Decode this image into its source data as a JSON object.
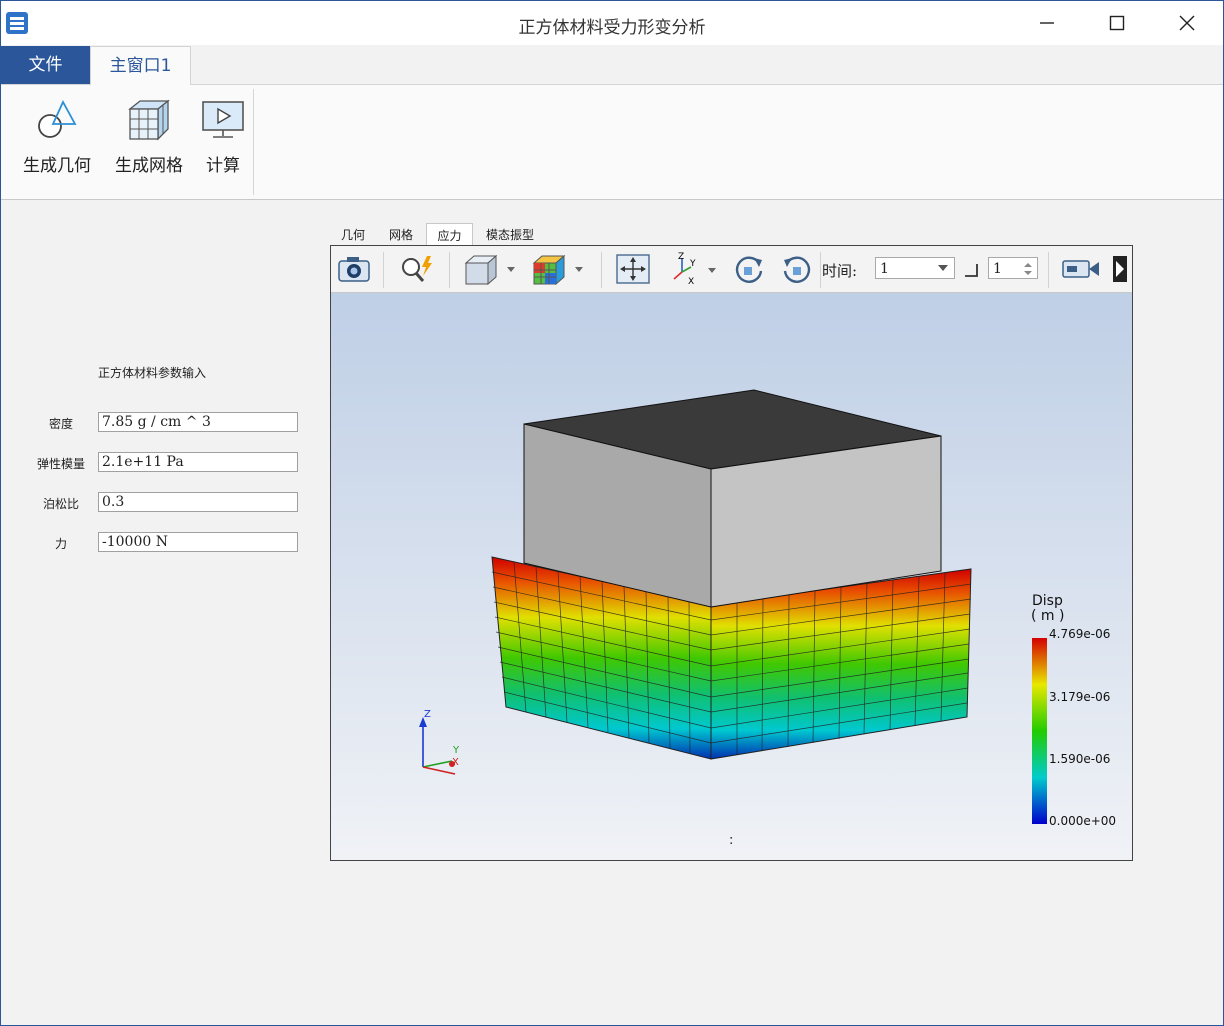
{
  "window": {
    "title": "正方体材料受力形变分析"
  },
  "ribbon": {
    "tabs": {
      "file": "文件",
      "main": "主窗口1"
    },
    "buttons": {
      "geometry": "生成几何",
      "mesh": "生成网格",
      "compute": "计算"
    }
  },
  "form": {
    "title": "正方体材料参数输入",
    "density": {
      "label": "密度",
      "value": "7.85 g / cm ^ 3"
    },
    "modulus": {
      "label": "弹性模量",
      "value": "2.1e+11 Pa"
    },
    "poisson": {
      "label": "泊松比",
      "value": "0.3"
    },
    "force": {
      "label": "力",
      "value": "-10000 N"
    }
  },
  "view_tabs": [
    "几何",
    "网格",
    "应力",
    "模态振型"
  ],
  "viewer": {
    "time_label": "时间:",
    "time_value": "1",
    "step_value": "1",
    "status_text": ":",
    "legend": {
      "title": "Disp",
      "unit": "( m )",
      "ticks": [
        "4.769e-06",
        "3.179e-06",
        "1.590e-06",
        "0.000e+00"
      ],
      "colors": [
        "#d40000",
        "#e8e800",
        "#22cc00",
        "#00cccc",
        "#0000cc"
      ]
    },
    "axes": {
      "z": "Z",
      "y": "Y",
      "x": "X"
    }
  }
}
